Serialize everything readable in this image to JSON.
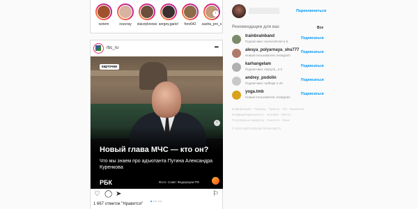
{
  "stories": [
    {
      "name": "ssriem",
      "color": "#a0522d"
    },
    {
      "name": "oozzray",
      "color": "#d8b4a0"
    },
    {
      "name": "staceyknows",
      "color": "#6b4f3a"
    },
    {
      "name": "sergey.garie!",
      "color": "#3b2f2f"
    },
    {
      "name": "foro642",
      "color": "#8b6b4a"
    },
    {
      "name": "sasha_pro_s",
      "color": "#c29b7a"
    }
  ],
  "post": {
    "username": "rbc_ru",
    "tag": "карточки",
    "headline": "Новый глава МЧС — кто он?",
    "subheadline": "Что мы знаем про адъютанта Путина Александра Куренкова",
    "brand": "РБК",
    "credit": "Фото: Совет Федерации РФ",
    "likes": "1 667 отметок \"Нравится\""
  },
  "sidebar": {
    "switch_label": "Переключиться",
    "rec_title": "Рекомендации для вас",
    "all_label": "Все",
    "follow_label": "Подписаться",
    "suggestions": [
      {
        "username": "trainbrainband",
        "subtitle": "Подписчики: serevectlovel и 8",
        "color": "#7a8a6a"
      },
      {
        "username": "alesya_polyarnaya_shu777",
        "subtitle": "Новый пользователь Instagram",
        "color": "#b07a6a"
      },
      {
        "username": "karhangelam",
        "subtitle": "Подписчики: ertjnyok_ и 5",
        "color": "#b0b0b0"
      },
      {
        "username": "andrey_podolin",
        "subtitle": "Подписчики: radhajar и 20",
        "color": "#c8c8c8"
      },
      {
        "username": "yoga.tmb",
        "subtitle": "Новый пользователь Instagram",
        "color": "#d9a21b"
      }
    ],
    "footer_links": "Информация · Помощь · Пресса · API · Вакансии · Конфиденциальность · Условия · Места · Популярные аккаунты · Хэштеги · Язык",
    "copyright": "© 2022 INSTAGRAM FROM META"
  }
}
